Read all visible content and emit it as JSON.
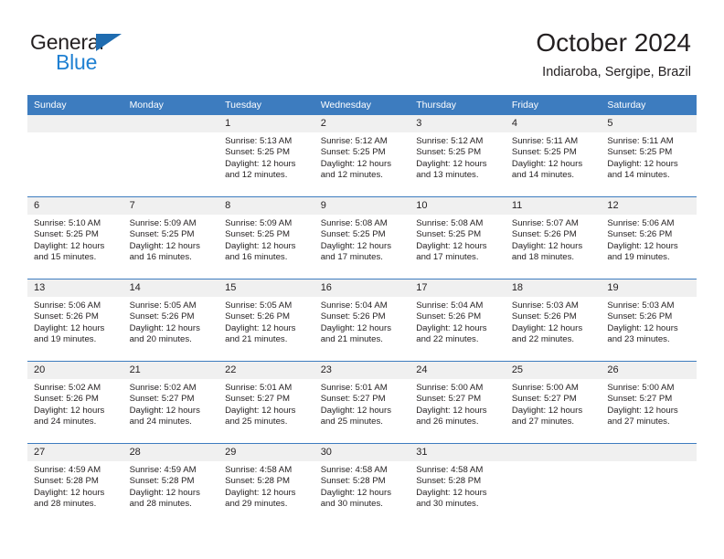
{
  "brand": {
    "name_part1": "General",
    "name_part2": "Blue",
    "accent_color": "#1f80d2",
    "triangle_color": "#1f6cb0"
  },
  "header": {
    "title": "October 2024",
    "subtitle": "Indiaroba, Sergipe, Brazil",
    "header_bg": "#3d7cbf",
    "daynum_bg": "#f0f0f0"
  },
  "weekdays": [
    "Sunday",
    "Monday",
    "Tuesday",
    "Wednesday",
    "Thursday",
    "Friday",
    "Saturday"
  ],
  "weeks": [
    [
      {
        "day": "",
        "lines": []
      },
      {
        "day": "",
        "lines": []
      },
      {
        "day": "1",
        "lines": [
          "Sunrise: 5:13 AM",
          "Sunset: 5:25 PM",
          "Daylight: 12 hours",
          "and 12 minutes."
        ]
      },
      {
        "day": "2",
        "lines": [
          "Sunrise: 5:12 AM",
          "Sunset: 5:25 PM",
          "Daylight: 12 hours",
          "and 12 minutes."
        ]
      },
      {
        "day": "3",
        "lines": [
          "Sunrise: 5:12 AM",
          "Sunset: 5:25 PM",
          "Daylight: 12 hours",
          "and 13 minutes."
        ]
      },
      {
        "day": "4",
        "lines": [
          "Sunrise: 5:11 AM",
          "Sunset: 5:25 PM",
          "Daylight: 12 hours",
          "and 14 minutes."
        ]
      },
      {
        "day": "5",
        "lines": [
          "Sunrise: 5:11 AM",
          "Sunset: 5:25 PM",
          "Daylight: 12 hours",
          "and 14 minutes."
        ]
      }
    ],
    [
      {
        "day": "6",
        "lines": [
          "Sunrise: 5:10 AM",
          "Sunset: 5:25 PM",
          "Daylight: 12 hours",
          "and 15 minutes."
        ]
      },
      {
        "day": "7",
        "lines": [
          "Sunrise: 5:09 AM",
          "Sunset: 5:25 PM",
          "Daylight: 12 hours",
          "and 16 minutes."
        ]
      },
      {
        "day": "8",
        "lines": [
          "Sunrise: 5:09 AM",
          "Sunset: 5:25 PM",
          "Daylight: 12 hours",
          "and 16 minutes."
        ]
      },
      {
        "day": "9",
        "lines": [
          "Sunrise: 5:08 AM",
          "Sunset: 5:25 PM",
          "Daylight: 12 hours",
          "and 17 minutes."
        ]
      },
      {
        "day": "10",
        "lines": [
          "Sunrise: 5:08 AM",
          "Sunset: 5:25 PM",
          "Daylight: 12 hours",
          "and 17 minutes."
        ]
      },
      {
        "day": "11",
        "lines": [
          "Sunrise: 5:07 AM",
          "Sunset: 5:26 PM",
          "Daylight: 12 hours",
          "and 18 minutes."
        ]
      },
      {
        "day": "12",
        "lines": [
          "Sunrise: 5:06 AM",
          "Sunset: 5:26 PM",
          "Daylight: 12 hours",
          "and 19 minutes."
        ]
      }
    ],
    [
      {
        "day": "13",
        "lines": [
          "Sunrise: 5:06 AM",
          "Sunset: 5:26 PM",
          "Daylight: 12 hours",
          "and 19 minutes."
        ]
      },
      {
        "day": "14",
        "lines": [
          "Sunrise: 5:05 AM",
          "Sunset: 5:26 PM",
          "Daylight: 12 hours",
          "and 20 minutes."
        ]
      },
      {
        "day": "15",
        "lines": [
          "Sunrise: 5:05 AM",
          "Sunset: 5:26 PM",
          "Daylight: 12 hours",
          "and 21 minutes."
        ]
      },
      {
        "day": "16",
        "lines": [
          "Sunrise: 5:04 AM",
          "Sunset: 5:26 PM",
          "Daylight: 12 hours",
          "and 21 minutes."
        ]
      },
      {
        "day": "17",
        "lines": [
          "Sunrise: 5:04 AM",
          "Sunset: 5:26 PM",
          "Daylight: 12 hours",
          "and 22 minutes."
        ]
      },
      {
        "day": "18",
        "lines": [
          "Sunrise: 5:03 AM",
          "Sunset: 5:26 PM",
          "Daylight: 12 hours",
          "and 22 minutes."
        ]
      },
      {
        "day": "19",
        "lines": [
          "Sunrise: 5:03 AM",
          "Sunset: 5:26 PM",
          "Daylight: 12 hours",
          "and 23 minutes."
        ]
      }
    ],
    [
      {
        "day": "20",
        "lines": [
          "Sunrise: 5:02 AM",
          "Sunset: 5:26 PM",
          "Daylight: 12 hours",
          "and 24 minutes."
        ]
      },
      {
        "day": "21",
        "lines": [
          "Sunrise: 5:02 AM",
          "Sunset: 5:27 PM",
          "Daylight: 12 hours",
          "and 24 minutes."
        ]
      },
      {
        "day": "22",
        "lines": [
          "Sunrise: 5:01 AM",
          "Sunset: 5:27 PM",
          "Daylight: 12 hours",
          "and 25 minutes."
        ]
      },
      {
        "day": "23",
        "lines": [
          "Sunrise: 5:01 AM",
          "Sunset: 5:27 PM",
          "Daylight: 12 hours",
          "and 25 minutes."
        ]
      },
      {
        "day": "24",
        "lines": [
          "Sunrise: 5:00 AM",
          "Sunset: 5:27 PM",
          "Daylight: 12 hours",
          "and 26 minutes."
        ]
      },
      {
        "day": "25",
        "lines": [
          "Sunrise: 5:00 AM",
          "Sunset: 5:27 PM",
          "Daylight: 12 hours",
          "and 27 minutes."
        ]
      },
      {
        "day": "26",
        "lines": [
          "Sunrise: 5:00 AM",
          "Sunset: 5:27 PM",
          "Daylight: 12 hours",
          "and 27 minutes."
        ]
      }
    ],
    [
      {
        "day": "27",
        "lines": [
          "Sunrise: 4:59 AM",
          "Sunset: 5:28 PM",
          "Daylight: 12 hours",
          "and 28 minutes."
        ]
      },
      {
        "day": "28",
        "lines": [
          "Sunrise: 4:59 AM",
          "Sunset: 5:28 PM",
          "Daylight: 12 hours",
          "and 28 minutes."
        ]
      },
      {
        "day": "29",
        "lines": [
          "Sunrise: 4:58 AM",
          "Sunset: 5:28 PM",
          "Daylight: 12 hours",
          "and 29 minutes."
        ]
      },
      {
        "day": "30",
        "lines": [
          "Sunrise: 4:58 AM",
          "Sunset: 5:28 PM",
          "Daylight: 12 hours",
          "and 30 minutes."
        ]
      },
      {
        "day": "31",
        "lines": [
          "Sunrise: 4:58 AM",
          "Sunset: 5:28 PM",
          "Daylight: 12 hours",
          "and 30 minutes."
        ]
      },
      {
        "day": "",
        "lines": []
      },
      {
        "day": "",
        "lines": []
      }
    ]
  ]
}
